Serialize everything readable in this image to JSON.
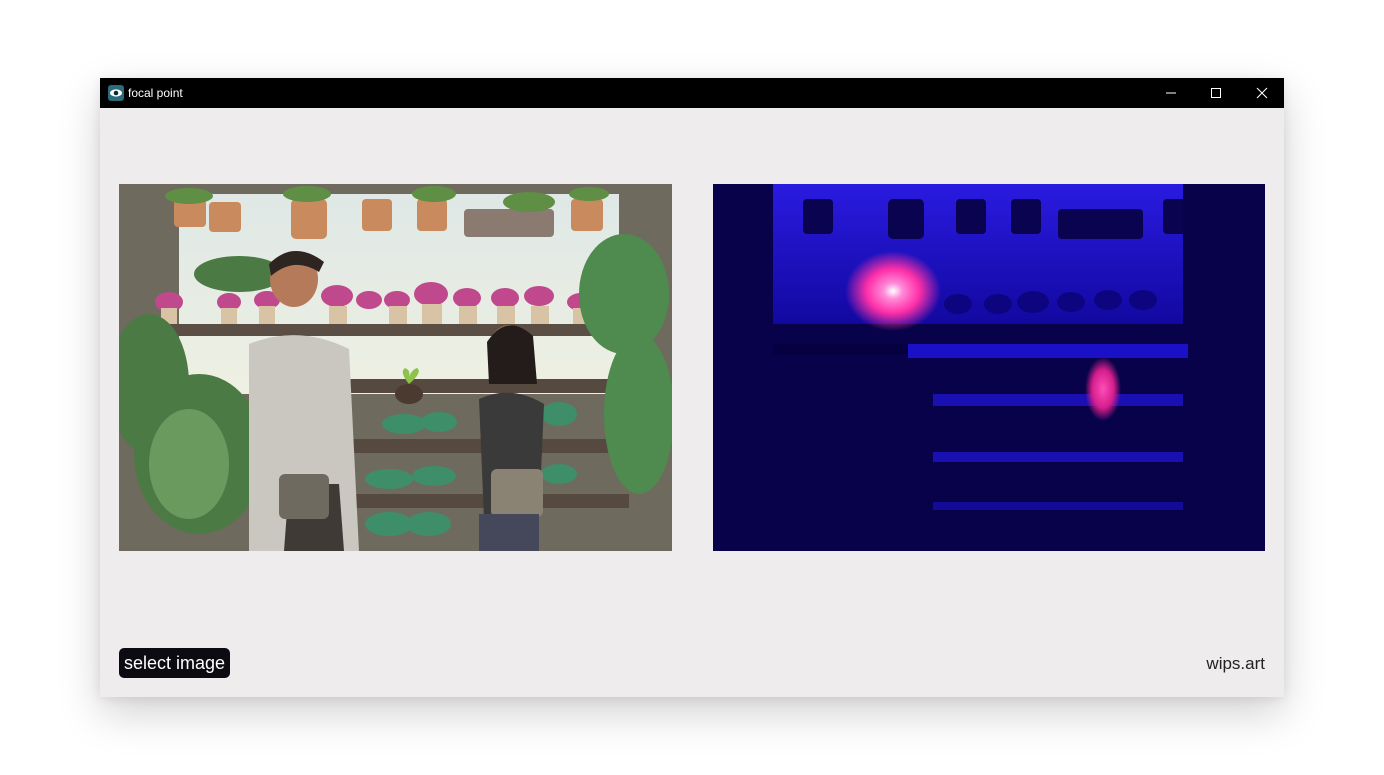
{
  "window": {
    "title": "focal point",
    "controls": [
      "minimize-icon",
      "maximize-icon",
      "close-icon"
    ]
  },
  "images": {
    "original": {
      "name": "artwork-image",
      "description_icon": "image"
    },
    "heatmap": {
      "name": "focal-heatmap-image"
    }
  },
  "actions": {
    "select_label": "select image"
  },
  "footer": {
    "credit": "wips.art"
  },
  "colors": {
    "titlebar": "#000000",
    "window_bg": "#eeeced",
    "button_bg": "#0c0b12",
    "heatmap_bg": "#060040",
    "heatmap_hot": "#ff2fa8"
  }
}
